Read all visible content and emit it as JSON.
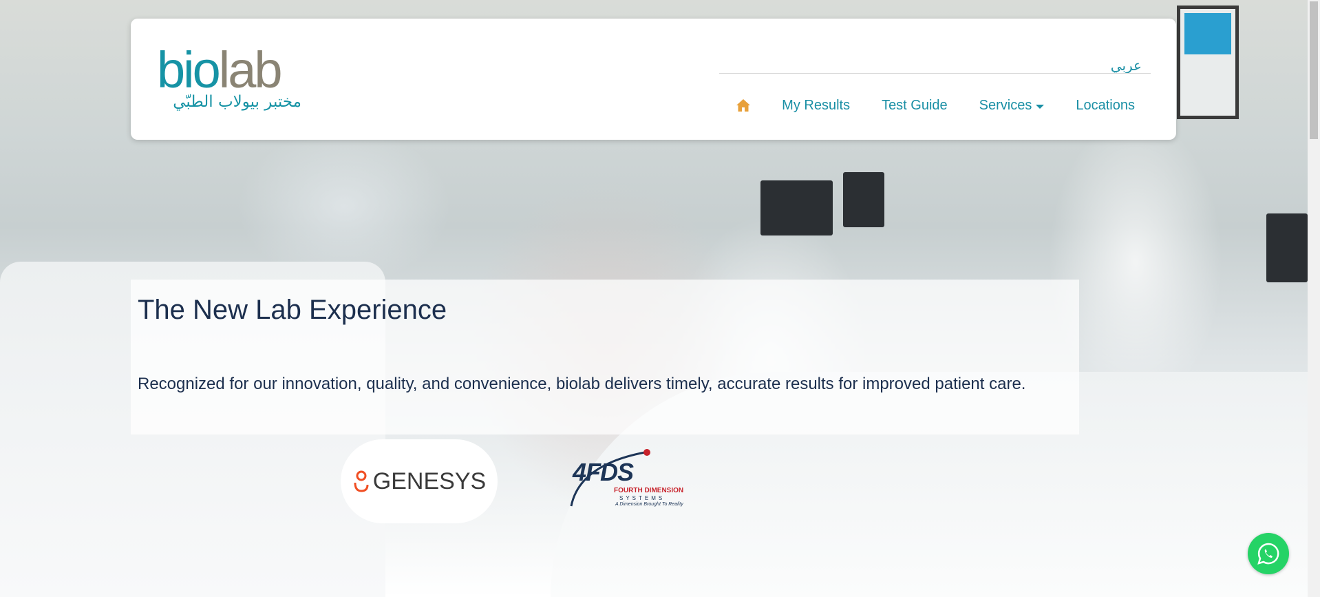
{
  "header": {
    "logo": {
      "latin_bio": "bio",
      "latin_lab": "lab",
      "arabic": "مختبر بيولاب الطبّي"
    },
    "language_link": "عربي",
    "nav": {
      "home_icon": "home-icon",
      "items": [
        {
          "label": "My Results"
        },
        {
          "label": "Test Guide"
        },
        {
          "label": "Services",
          "has_dropdown": true
        },
        {
          "label": "Locations"
        }
      ]
    }
  },
  "hero": {
    "title": "The New Lab Experience",
    "text": "Recognized for our innovation, quality, and convenience, biolab delivers timely, accurate results for improved patient care."
  },
  "partners": {
    "genesys": {
      "name": "GENESYS"
    },
    "fds": {
      "main": "4FDS",
      "line1": "FOURTH DIMENSION",
      "line2": "SYSTEMS",
      "line3": "A Dimension Brought To Reality"
    }
  },
  "floating": {
    "whatsapp_icon": "whatsapp-icon"
  },
  "colors": {
    "brand_teal": "#1a8fa5",
    "logo_gray": "#8a8474",
    "home_icon": "#e8a03a",
    "hero_text": "#1c2f4e",
    "whatsapp": "#25d366"
  }
}
